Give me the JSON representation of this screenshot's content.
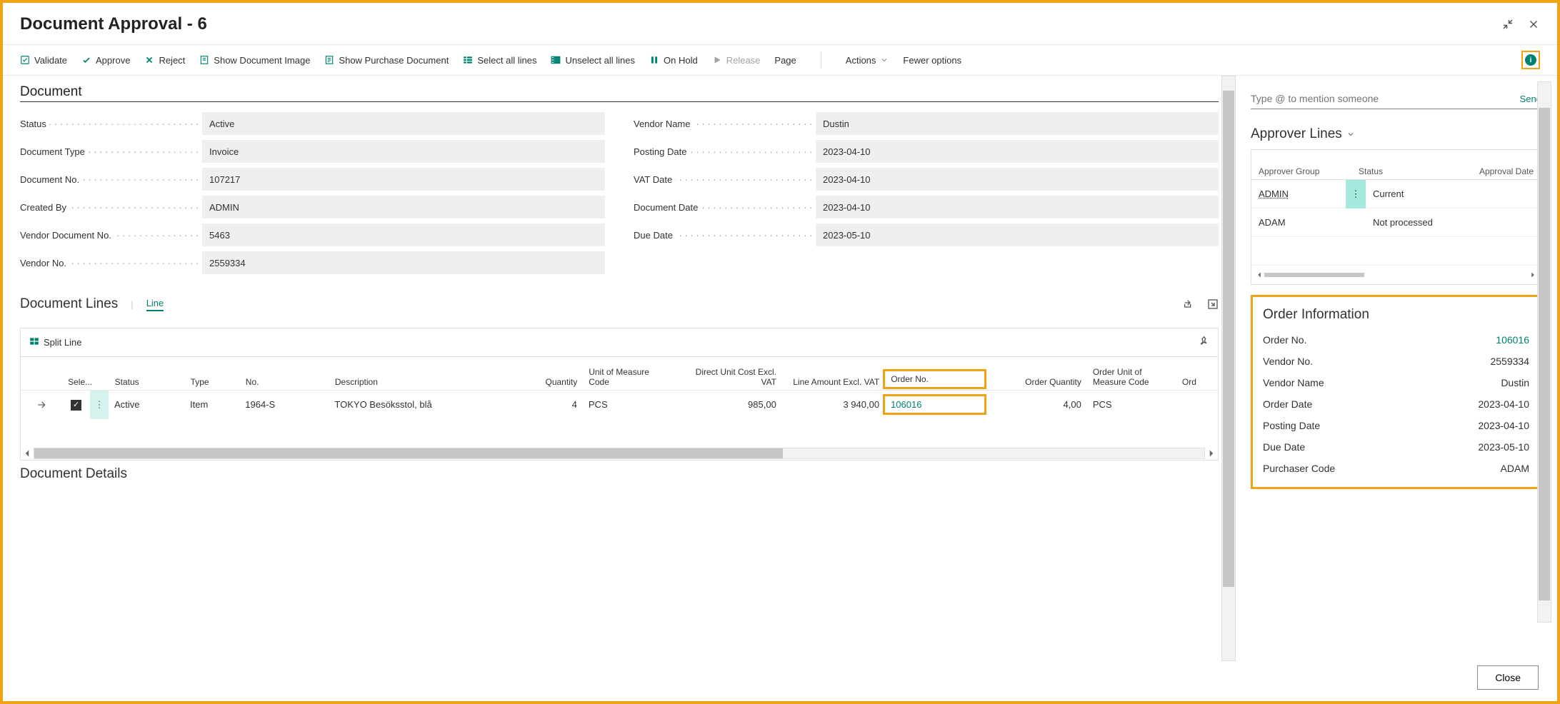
{
  "header": {
    "title": "Document Approval - 6"
  },
  "toolbar": {
    "validate": "Validate",
    "approve": "Approve",
    "reject": "Reject",
    "show_doc_image": "Show Document Image",
    "show_purchase_doc": "Show Purchase Document",
    "select_all": "Select all lines",
    "unselect_all": "Unselect all lines",
    "on_hold": "On Hold",
    "release": "Release",
    "page": "Page",
    "actions": "Actions",
    "fewer_options": "Fewer options"
  },
  "section_document": "Document",
  "document_fields_left": {
    "status": {
      "label": "Status",
      "value": "Active"
    },
    "doc_type": {
      "label": "Document Type",
      "value": "Invoice"
    },
    "doc_no": {
      "label": "Document No.",
      "value": "107217"
    },
    "created_by": {
      "label": "Created By",
      "value": "ADMIN"
    },
    "vendor_doc_no": {
      "label": "Vendor Document No.",
      "value": "5463"
    },
    "vendor_no": {
      "label": "Vendor No.",
      "value": "2559334"
    }
  },
  "document_fields_right": {
    "vendor_name": {
      "label": "Vendor Name",
      "value": "Dustin"
    },
    "posting_date": {
      "label": "Posting Date",
      "value": "2023-04-10"
    },
    "vat_date": {
      "label": "VAT Date",
      "value": "2023-04-10"
    },
    "document_date": {
      "label": "Document Date",
      "value": "2023-04-10"
    },
    "due_date": {
      "label": "Due Date",
      "value": "2023-05-10"
    }
  },
  "document_lines": {
    "section_title": "Document Lines",
    "line_link": "Line",
    "split_line": "Split Line",
    "columns": {
      "sele": "Sele...",
      "status": "Status",
      "type": "Type",
      "no": "No.",
      "description": "Description",
      "quantity": "Quantity",
      "uom_code": "Unit of Measure Code",
      "direct_unit_cost": "Direct Unit Cost Excl. VAT",
      "line_amount": "Line Amount Excl. VAT",
      "order_no": "Order No.",
      "order_qty": "Order Quantity",
      "order_uom_code": "Order Unit of Measure Code",
      "ord": "Ord"
    },
    "rows": [
      {
        "selected": true,
        "status": "Active",
        "type": "Item",
        "no": "1964-S",
        "description": "TOKYO Besöksstol, blå",
        "quantity": "4",
        "uom_code": "PCS",
        "direct_unit_cost": "985,00",
        "line_amount": "3 940,00",
        "order_no": "106016",
        "order_qty": "4,00",
        "order_uom_code": "PCS"
      }
    ]
  },
  "document_details": {
    "title": "Document Details"
  },
  "side": {
    "mention": {
      "placeholder": "Type @ to mention someone",
      "send": "Send"
    },
    "approver_lines": {
      "title": "Approver Lines",
      "columns": {
        "group": "Approver Group",
        "status": "Status",
        "approval_date": "Approval Date"
      },
      "rows": [
        {
          "group": "ADMIN",
          "status": "Current",
          "approval_date": ""
        },
        {
          "group": "ADAM",
          "status": "Not processed",
          "approval_date": ""
        }
      ]
    },
    "order_info": {
      "title": "Order Information",
      "order_no": {
        "label": "Order No.",
        "value": "106016"
      },
      "vendor_no": {
        "label": "Vendor No.",
        "value": "2559334"
      },
      "vendor_name": {
        "label": "Vendor Name",
        "value": "Dustin"
      },
      "order_date": {
        "label": "Order Date",
        "value": "2023-04-10"
      },
      "posting_date": {
        "label": "Posting Date",
        "value": "2023-04-10"
      },
      "due_date": {
        "label": "Due Date",
        "value": "2023-05-10"
      },
      "purchaser_code": {
        "label": "Purchaser Code",
        "value": "ADAM"
      }
    }
  },
  "footer": {
    "close": "Close"
  }
}
